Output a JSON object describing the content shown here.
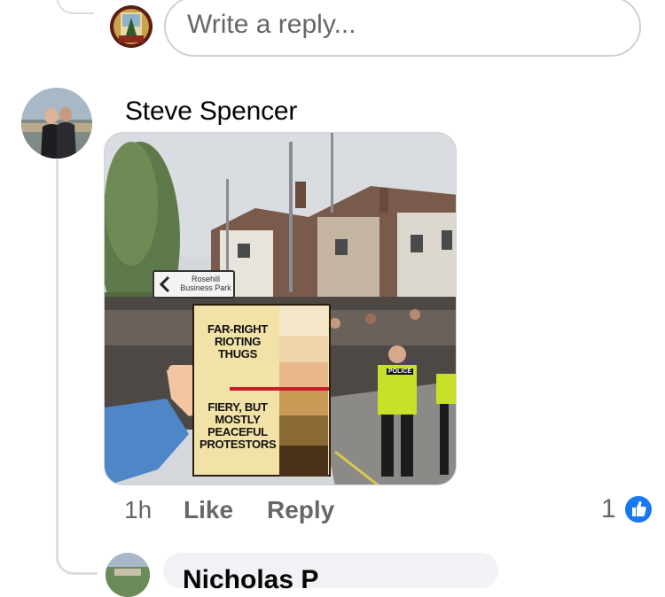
{
  "reply_input": {
    "placeholder": "Write a reply..."
  },
  "comment": {
    "author": "Steve Spencer",
    "image": {
      "road_sign": "Rosehill Business Park",
      "meme_top_label": "FAR-RIGHT RIOTING THUGS",
      "meme_bottom_label": "FIERY, BUT MOSTLY PEACEFUL PROTESTORS",
      "police_vest_text": "POLICE"
    },
    "timestamp": "1h",
    "like_label": "Like",
    "reply_label": "Reply",
    "reaction_count": "1",
    "reaction_icon": "thumbs-up-icon"
  },
  "next_comment": {
    "author_partial": "Nicholas P"
  },
  "colors": {
    "facebook_blue": "#1877f2",
    "meta_gray": "#65676b",
    "thread_line": "#dadde1",
    "bubble_bg": "#f0f2f5"
  }
}
